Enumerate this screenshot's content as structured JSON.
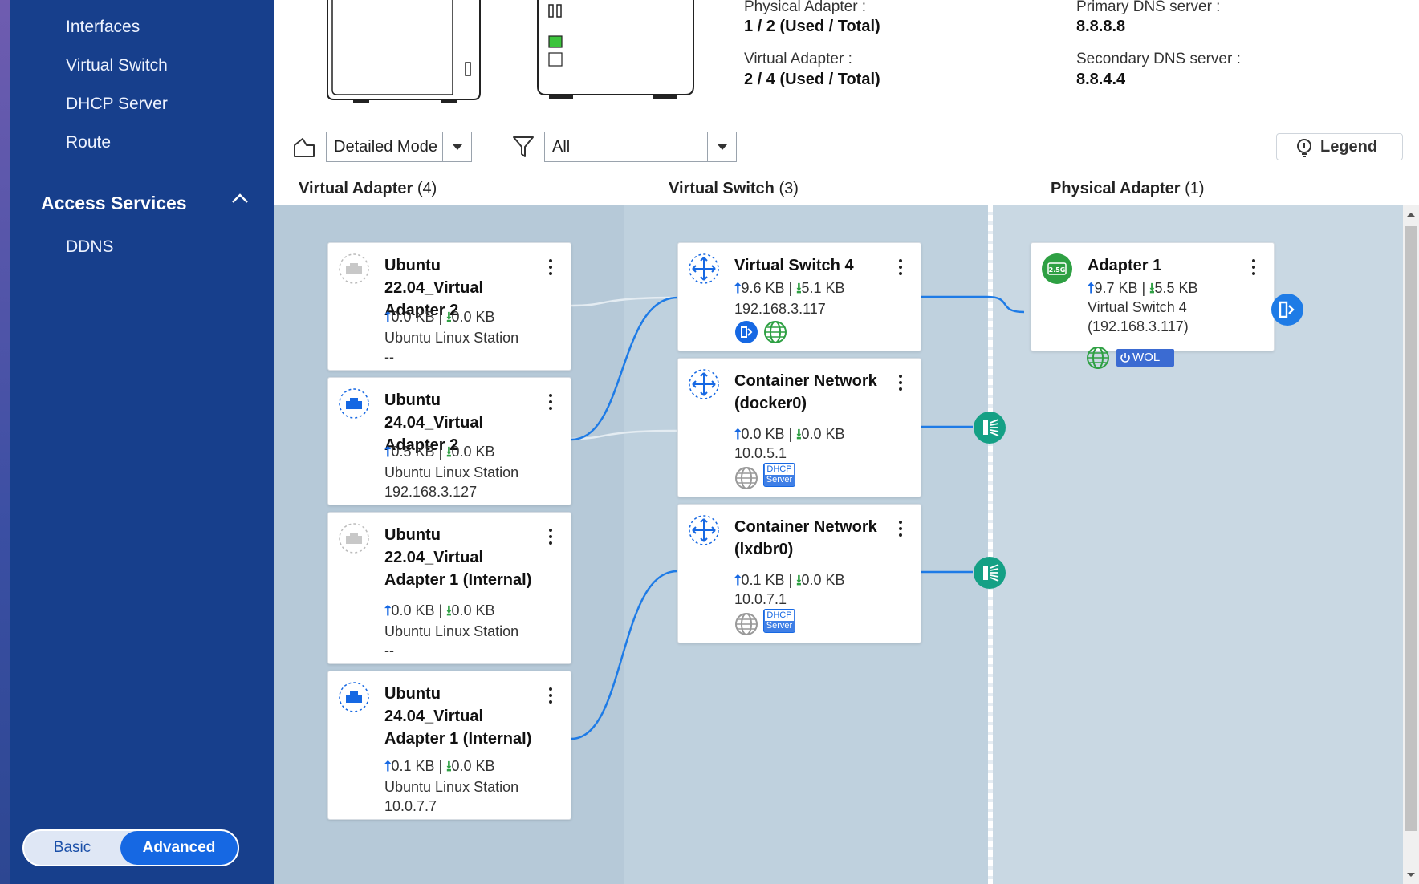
{
  "sidebar": {
    "items": [
      "Interfaces",
      "Virtual Switch",
      "DHCP Server",
      "Route"
    ],
    "section_title": "Access Services",
    "section_items": [
      "DDNS"
    ],
    "mode": {
      "basic": "Basic",
      "advanced": "Advanced",
      "selected": "Advanced"
    }
  },
  "overview": {
    "physical_label": "Physical Adapter :",
    "physical_value": "1 / 2 (Used / Total)",
    "virtual_label": "Virtual Adapter :",
    "virtual_value": "2 / 4 (Used / Total)",
    "dns1_label": "Primary DNS server :",
    "dns1_value": "8.8.8.8",
    "dns2_label": "Secondary DNS server :",
    "dns2_value": "8.8.4.4"
  },
  "toolbar": {
    "view_mode": "Detailed Mode",
    "filter": "All",
    "legend": "Legend"
  },
  "columns": [
    {
      "title": "Virtual Adapter",
      "count": "(4)"
    },
    {
      "title": "Virtual Switch",
      "count": "(3)"
    },
    {
      "title": "Physical Adapter",
      "count": "(1)"
    }
  ],
  "virtual_adapters": [
    {
      "title": "Ubuntu 22.04_Virtual Adapter 2",
      "up": "0.0 KB",
      "down": "0.0 KB",
      "host": "Ubuntu Linux Station",
      "ip": "--"
    },
    {
      "title": "Ubuntu 24.04_Virtual Adapter 2",
      "up": "0.5 KB",
      "down": "0.0 KB",
      "host": "Ubuntu Linux Station",
      "ip": "192.168.3.127"
    },
    {
      "title": "Ubuntu 22.04_Virtual Adapter 1 (Internal)",
      "up": "0.0 KB",
      "down": "0.0 KB",
      "host": "Ubuntu Linux Station",
      "ip": "--"
    },
    {
      "title": "Ubuntu 24.04_Virtual Adapter 1 (Internal)",
      "up": "0.1 KB",
      "down": "0.0 KB",
      "host": "Ubuntu Linux Station",
      "ip": "10.0.7.7"
    }
  ],
  "virtual_switches": [
    {
      "title": "Virtual Switch 4",
      "up": "9.6 KB",
      "down": "5.1 KB",
      "ip": "192.168.3.117"
    },
    {
      "title": "Container Network (docker0)",
      "up": "0.0 KB",
      "down": "0.0 KB",
      "ip": "10.0.5.1",
      "badge_top": "DHCP",
      "badge_bottom": "Server"
    },
    {
      "title": "Container Network (lxdbr0)",
      "up": "0.1 KB",
      "down": "0.0 KB",
      "ip": "10.0.7.1",
      "badge_top": "DHCP",
      "badge_bottom": "Server"
    }
  ],
  "physical_adapters": [
    {
      "title": "Adapter 1",
      "speed_badge": "2.5G",
      "up": "9.7 KB",
      "down": "5.5 KB",
      "switch": "Virtual Switch 4",
      "switch_ip": "(192.168.3.117)",
      "wol": "WOL"
    }
  ],
  "colors": {
    "sidebar": "#173f8c",
    "accent": "#1668e3",
    "link_line": "#1e7be6",
    "teal": "#14a085",
    "green": "#2ea043"
  }
}
